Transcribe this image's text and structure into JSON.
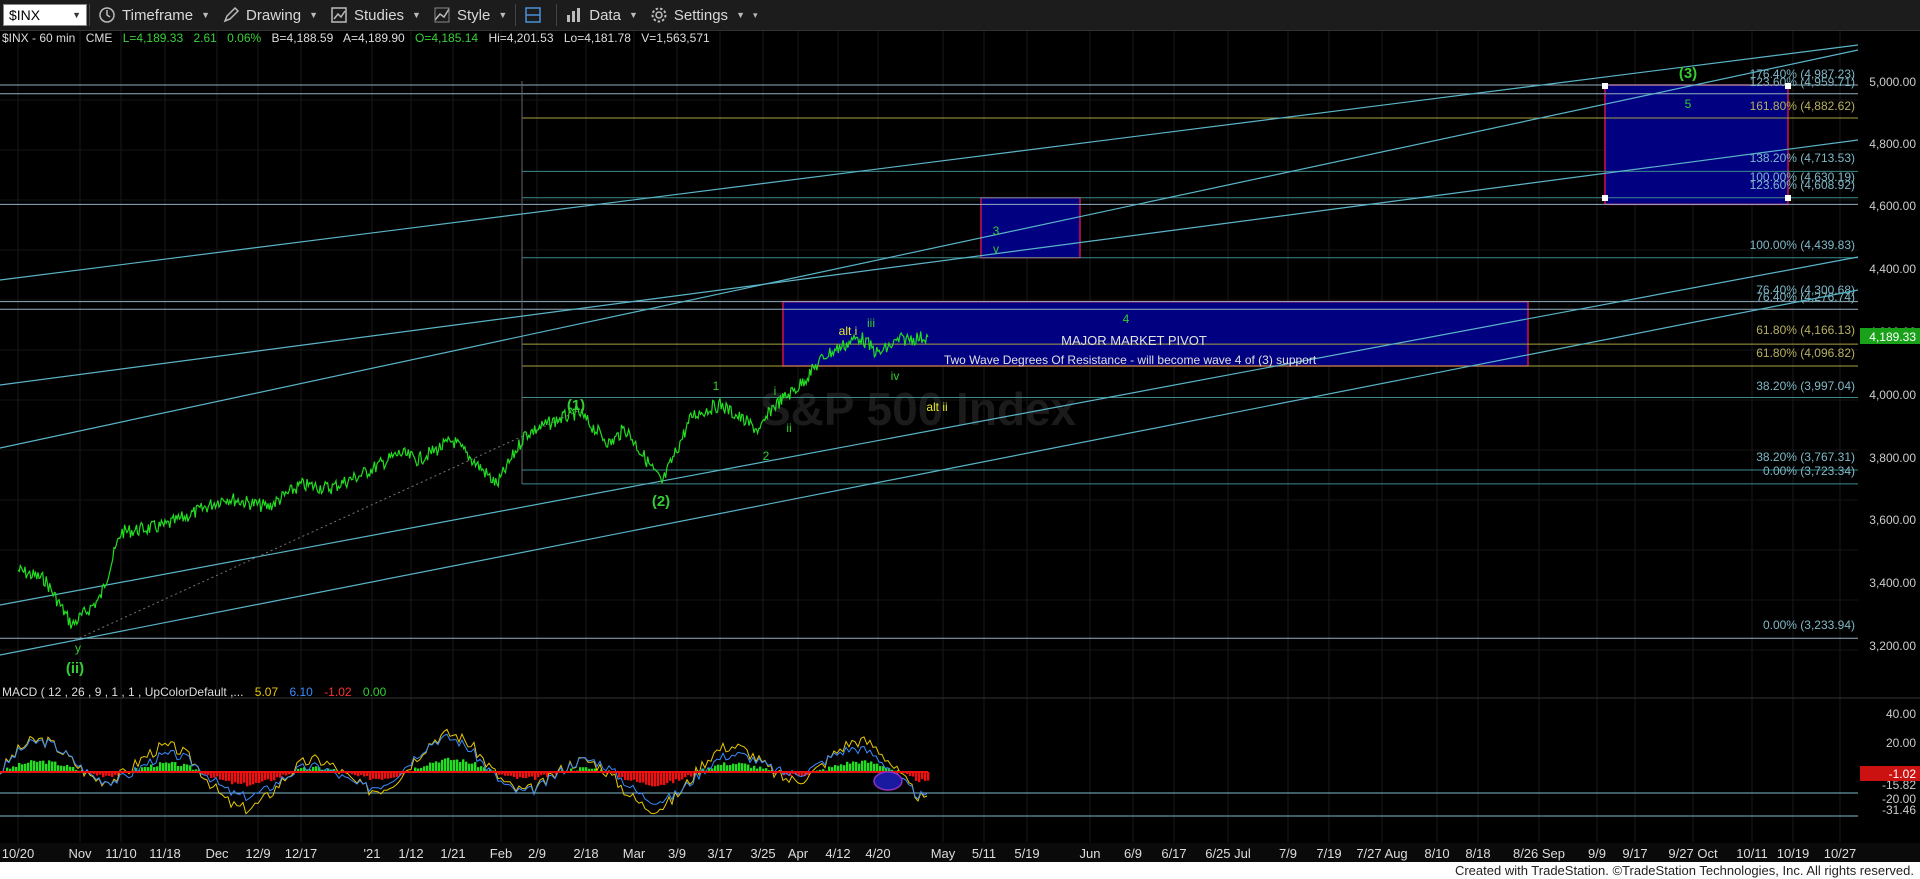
{
  "toolbar": {
    "symbol": "$INX",
    "timeframe_label": "Timeframe",
    "drawing_label": "Drawing",
    "studies_label": "Studies",
    "style_label": "Style",
    "data_label": "Data",
    "settings_label": "Settings"
  },
  "status": {
    "symbol": "$INX - 60 min",
    "exchange": "CME",
    "last": "L=4,189.33",
    "change": "2.61",
    "pct": "0.06%",
    "bid": "B=4,188.59",
    "ask": "A=4,189.90",
    "open": "O=4,185.14",
    "high": "Hi=4,201.53",
    "low": "Lo=4,181.78",
    "volume": "V=1,563,571"
  },
  "macd": {
    "label": "MACD ( 12 , 26 , 9 , 1 , 1 , UpColorDefault ,...",
    "v1": "5.07",
    "v2": "6.10",
    "v3": "-1.02",
    "v4": "0.00"
  },
  "footer": "Created with TradeStation. ©TradeStation Technologies, Inc. All rights reserved.",
  "colors": {
    "background": "#000000",
    "price": "#22dd22",
    "channel": "#5ab4c8",
    "fib_level": "#7fbfbf",
    "fib_gold": "#a8a040",
    "box_fill": "#000088",
    "box_border": "#d01050",
    "wave_green": "#33cc33",
    "wave_yellow": "#e8e830"
  },
  "chart_data": {
    "type": "line",
    "title": "",
    "series": [
      {
        "name": "$INX - 60 min",
        "points": [
          [
            "10/20",
            3450
          ],
          [
            "10/26",
            3420
          ],
          [
            "Oct 30",
            3275
          ],
          [
            "11/4",
            3360
          ],
          [
            "11/10",
            3570
          ],
          [
            "11/18",
            3590
          ],
          [
            "11/27",
            3640
          ],
          [
            "12/4",
            3680
          ],
          [
            "12/11",
            3650
          ],
          [
            "12/17",
            3720
          ],
          [
            "12/24",
            3710
          ],
          [
            "12/31",
            3750
          ],
          [
            "1/8",
            3820
          ],
          [
            "1/14",
            3800
          ],
          [
            "1/21",
            3860
          ],
          [
            "1/27",
            3760
          ],
          [
            "1/29",
            3720
          ],
          [
            "2/5",
            3880
          ],
          [
            "2/12",
            3930
          ],
          [
            "2/16",
            3950
          ],
          [
            "2/23",
            3850
          ],
          [
            "3/1",
            3900
          ],
          [
            "3/4",
            3725
          ],
          [
            "3/11",
            3940
          ],
          [
            "3/17",
            3975
          ],
          [
            "3/24",
            3890
          ],
          [
            "3/26",
            3965
          ],
          [
            "4/1",
            4030
          ],
          [
            "4/9",
            4130
          ],
          [
            "4/16",
            4190
          ],
          [
            "4/20",
            4135
          ],
          [
            "4/23",
            4180
          ],
          [
            "4/29",
            4189.33
          ]
        ]
      },
      {
        "name": "MACD",
        "values": [
          5.07,
          6.1,
          -1.02,
          0.0
        ]
      }
    ],
    "x_tick_labels": [
      "10/20",
      "Nov",
      "11/10",
      "11/18",
      "Dec",
      "12/9",
      "12/17",
      "'21",
      "1/12",
      "1/21",
      "Feb",
      "2/9",
      "2/18",
      "Mar",
      "3/9",
      "3/17",
      "3/25",
      "Apr",
      "4/12",
      "4/20",
      "May",
      "5/11",
      "5/19",
      "Jun",
      "6/9",
      "6/17",
      "6/25 Jul",
      "7/9",
      "7/19",
      "7/27 Aug",
      "8/10",
      "8/18",
      "8/26 Sep",
      "9/9",
      "9/17",
      "9/27 Oct",
      "10/11",
      "10/19",
      "10/27"
    ],
    "y_tick_labels": [
      "5,000.00",
      "4,800.00",
      "4,600.00",
      "4,400.00",
      "4,200.00",
      "4,000.00",
      "3,800.00",
      "3,600.00",
      "3,400.00",
      "3,200.00"
    ],
    "ylim": [
      3150,
      5050
    ],
    "current_price_label": "4,189.33",
    "macd_tick_labels": [
      "40.00",
      "20.00",
      "-15.82",
      "-20.00",
      "-31.46"
    ],
    "macd_current_label": "-1.02",
    "fib_levels": [
      {
        "label": "176.40% (4,987.23)",
        "value": 4987.23
      },
      {
        "label": "123.60% (4,959.71)",
        "value": 4959.71
      },
      {
        "label": "161.80% (4,882.62)",
        "value": 4882.62
      },
      {
        "label": "138.20% (4,713.53)",
        "value": 4713.53
      },
      {
        "label": "100.00% (4,630.19)",
        "value": 4630.19
      },
      {
        "label": "123.60% (4,608.92)",
        "value": 4608.92
      },
      {
        "label": "100.00% (4,439.83)",
        "value": 4439.83
      },
      {
        "label": "76.40% (4,300.68)",
        "value": 4300.68
      },
      {
        "label": "76.40% (4,276.74)",
        "value": 4276.74
      },
      {
        "label": "61.80% (4,166.13)",
        "value": 4166.13
      },
      {
        "label": "61.80% (4,096.82)",
        "value": 4096.82
      },
      {
        "label": "38.20% (3,997.04)",
        "value": 3997.04
      },
      {
        "label": "38.20% (3,767.31)",
        "value": 3767.31
      },
      {
        "label": "0.00% (3,723.34)",
        "value": 3723.34
      },
      {
        "label": "0.00% (3,233.94)",
        "value": 3233.94
      }
    ],
    "boxes": [
      {
        "name": "major-pivot",
        "from": "Apr",
        "to": "8/26 Sep",
        "y_low": 4096.82,
        "y_high": 4300.68
      },
      {
        "name": "wave-3-target",
        "from": "5/11",
        "to": "Jun",
        "y_low": 4439.83,
        "y_high": 4630.19
      },
      {
        "name": "wave-5-target",
        "from": "9/9",
        "to": "10/11",
        "y_low": 4608.92,
        "y_high": 4987.23
      }
    ],
    "annotations": {
      "pivot_title": "MAJOR MARKET PIVOT",
      "pivot_subtitle": "Two Wave Degrees Of Resistance - will become wave 4 of (3) support",
      "wave_labels": [
        "(3)",
        "5",
        "3",
        "v",
        "4",
        "alt i",
        "iii",
        "iv",
        "alt ii",
        "(1)",
        "1",
        "i",
        "ii",
        "2",
        "(2)",
        "y",
        "(ii)"
      ]
    },
    "watermark": "S&P 500 Index",
    "grid": true,
    "legend": "none"
  }
}
